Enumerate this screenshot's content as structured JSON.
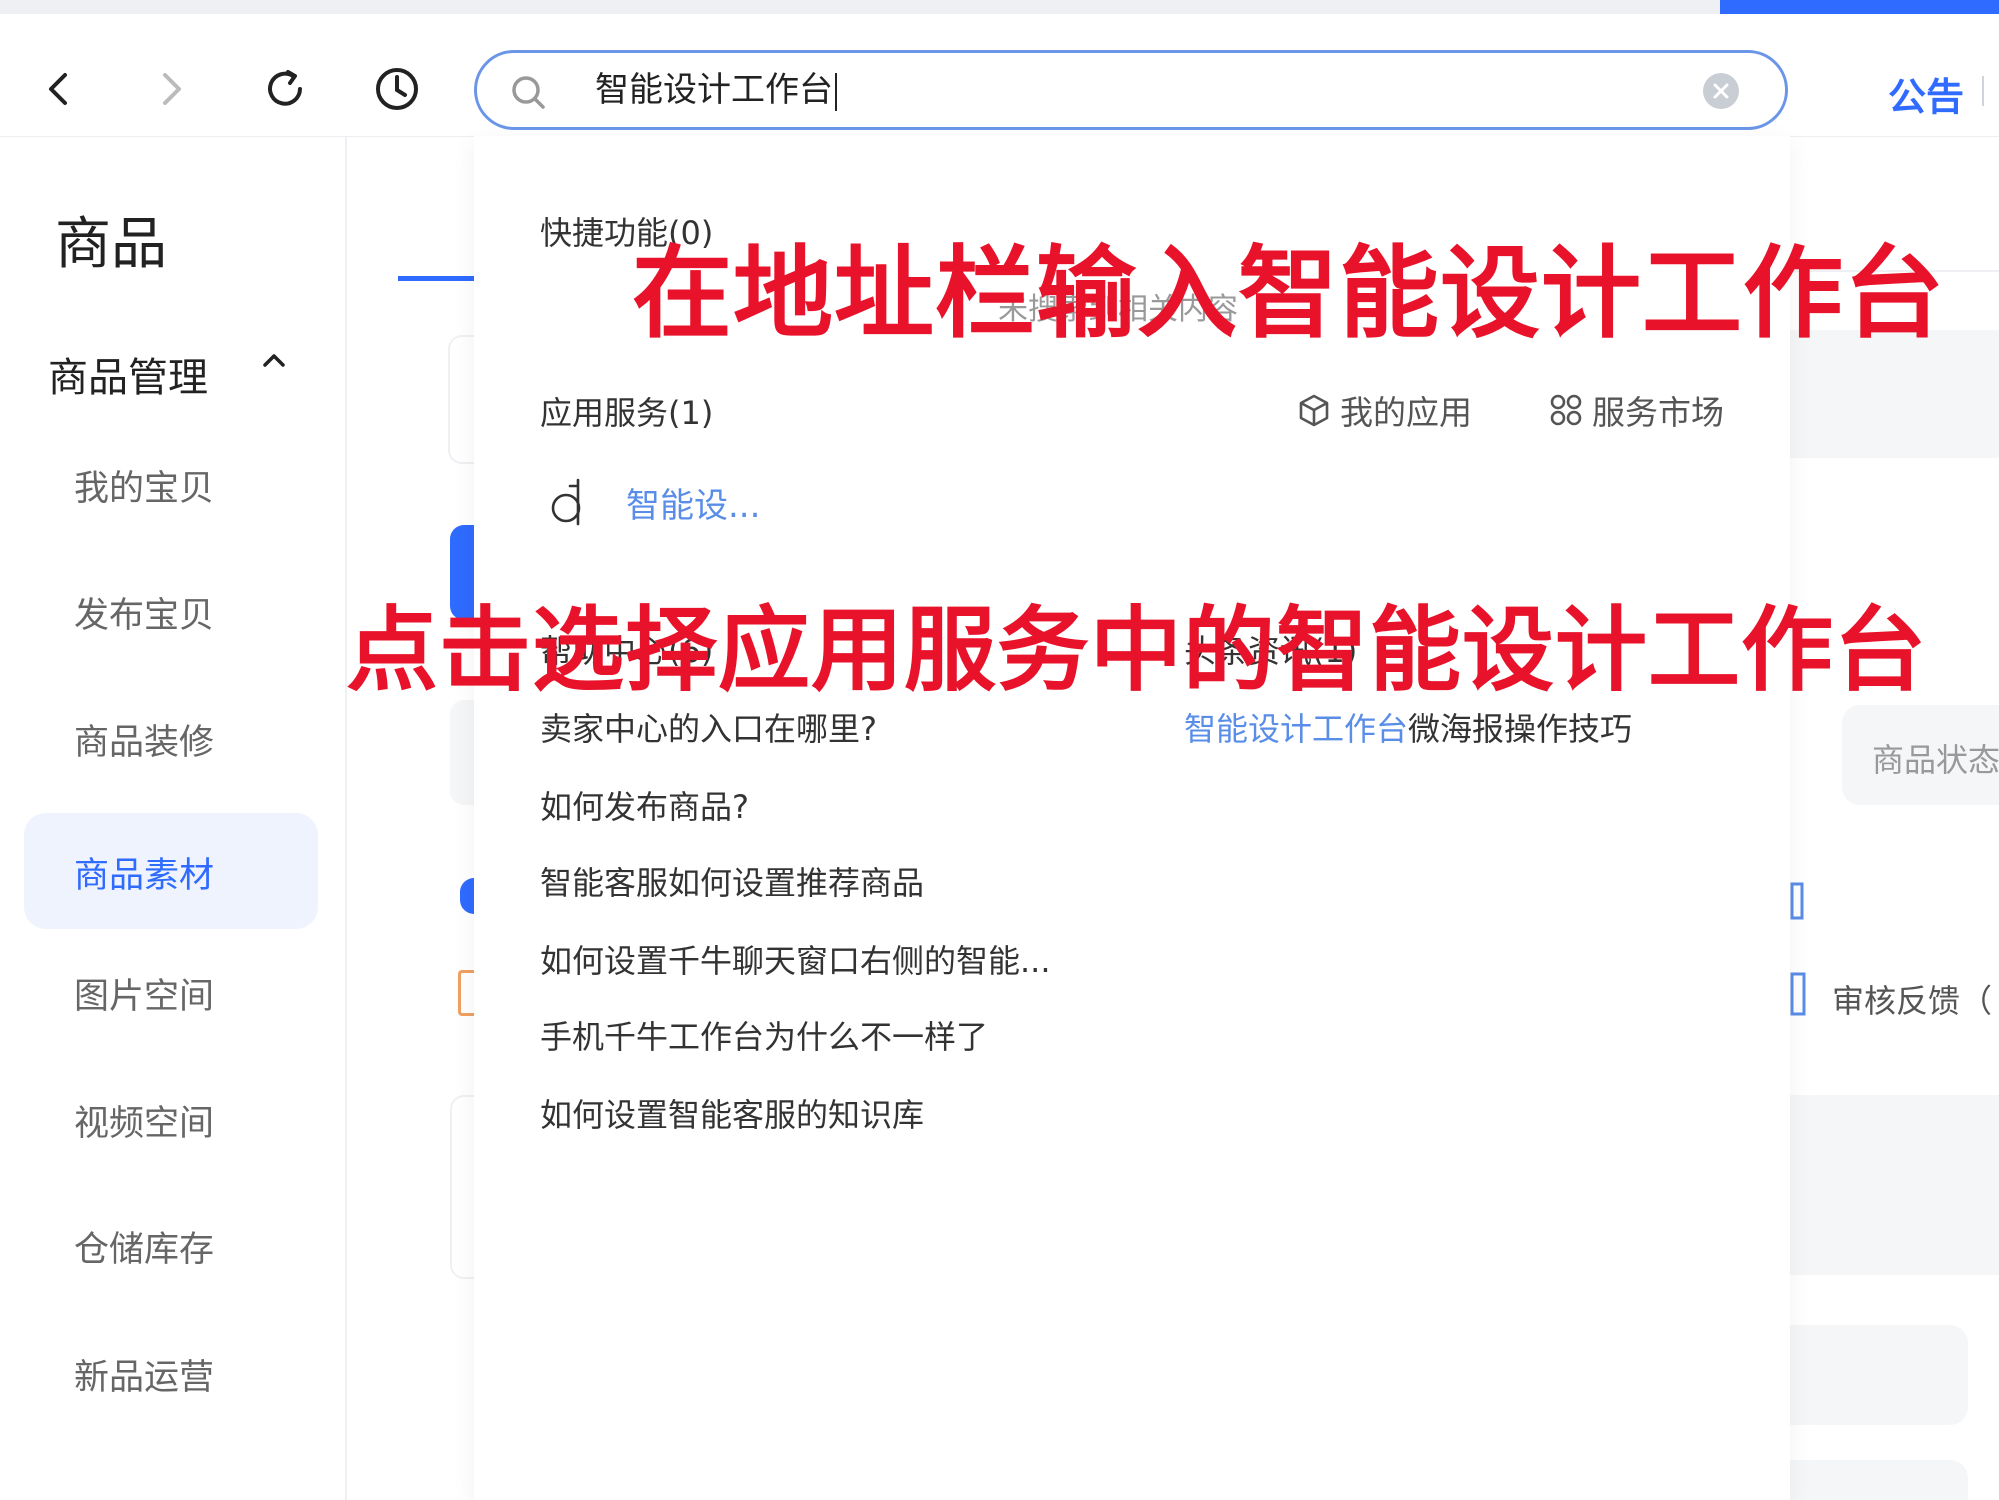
{
  "toolbar": {
    "search_value": "智能设计工作台",
    "notice_label": "公告"
  },
  "sidebar": {
    "title": "商品",
    "group_label": "商品管理",
    "items": [
      {
        "label": "我的宝贝"
      },
      {
        "label": "发布宝贝"
      },
      {
        "label": "商品装修"
      },
      {
        "label": "商品素材",
        "active": true
      },
      {
        "label": "图片空间"
      },
      {
        "label": "视频空间"
      },
      {
        "label": "仓储库存"
      },
      {
        "label": "新品运营"
      }
    ]
  },
  "background": {
    "status_pill": "商品状态",
    "audit_label": "审核反馈（"
  },
  "dropdown": {
    "quick_heading": "快捷功能(0)",
    "quick_empty": "未搜索到相关内容",
    "apps_heading": "应用服务(1)",
    "my_apps_label": "我的应用",
    "market_label": "服务市场",
    "app_result": "智能设...",
    "help_heading": "帮助中心(6)",
    "news_heading": "头条资讯(1)",
    "help_items": [
      "卖家中心的入口在哪里?",
      "如何发布商品?",
      "智能客服如何设置推荐商品",
      "如何设置千牛聊天窗口右侧的智能...",
      "手机千牛工作台为什么不一样了",
      "如何设置智能客服的知识库"
    ],
    "news_highlight": "智能设计工作台",
    "news_rest": "微海报操作技巧"
  },
  "annotations": {
    "step1": "在地址栏输入智能设计工作台",
    "step2": "点击选择应用服务中的智能设计工作台"
  },
  "colors": {
    "accent": "#2f6bff",
    "annotation": "#e8132a"
  }
}
